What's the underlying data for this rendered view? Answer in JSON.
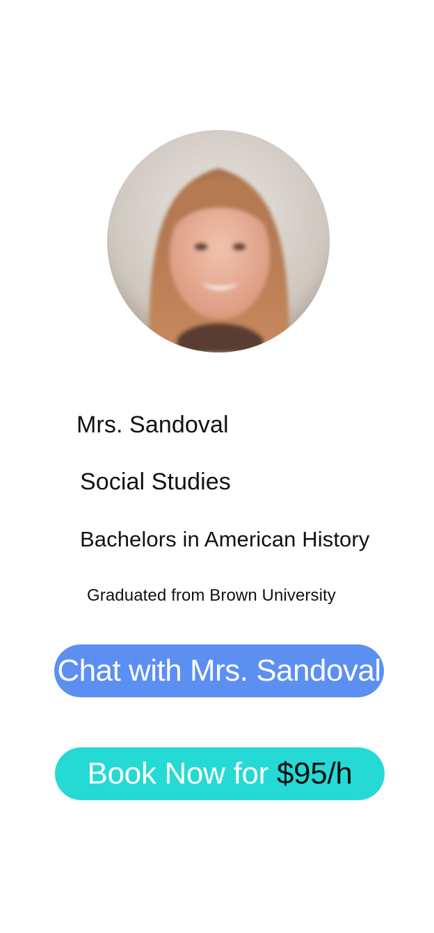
{
  "profile": {
    "avatar_alt": "Mrs. Sandoval profile photo",
    "name": "Mrs. Sandoval",
    "subject": "Social Studies",
    "degree": "Bachelors in American History",
    "education": "Graduated from Brown University"
  },
  "actions": {
    "chat_label": "Chat with Mrs. Sandoval",
    "book_label": "Book Now for",
    "book_price": "$95/h"
  },
  "colors": {
    "chat_button": "#5b8ff1",
    "book_button": "#25d9d4"
  }
}
